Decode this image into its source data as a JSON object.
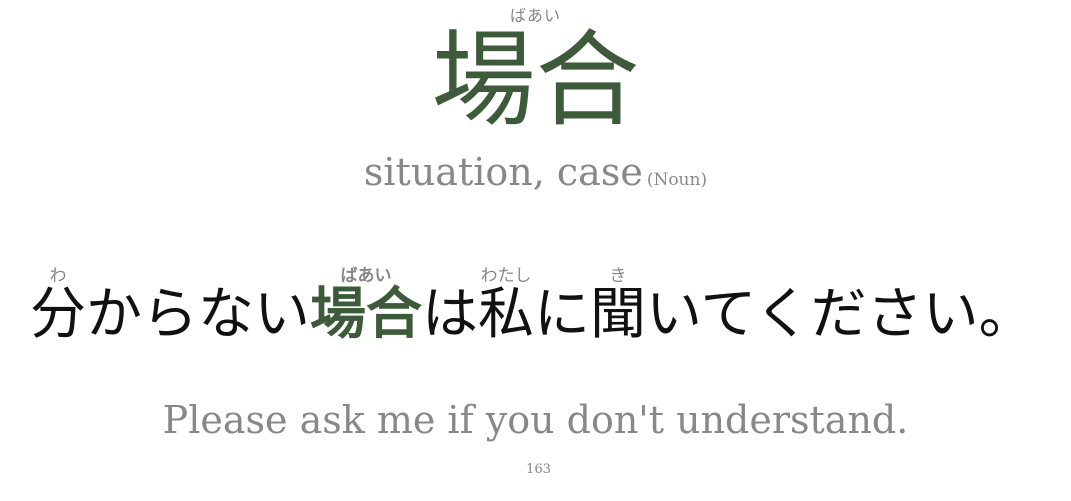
{
  "word": {
    "reading": "ばあい",
    "kanji": "場合",
    "meaning": "situation, case",
    "part_of_speech": "(Noun)"
  },
  "sentence": {
    "segments": [
      {
        "text": "分",
        "ruby": "わ"
      },
      {
        "text": "からない",
        "ruby": ""
      },
      {
        "text": "場合",
        "ruby": "ばあい",
        "highlight": true
      },
      {
        "text": "は",
        "ruby": ""
      },
      {
        "text": "私",
        "ruby": "わたし"
      },
      {
        "text": "に",
        "ruby": ""
      },
      {
        "text": "聞",
        "ruby": "き"
      },
      {
        "text": "いてください。",
        "ruby": ""
      }
    ],
    "translation": "Please ask me if you don't understand."
  },
  "page_number": "163",
  "colors": {
    "accent": "#3d5a3a",
    "muted": "#888888",
    "text": "#111111"
  }
}
